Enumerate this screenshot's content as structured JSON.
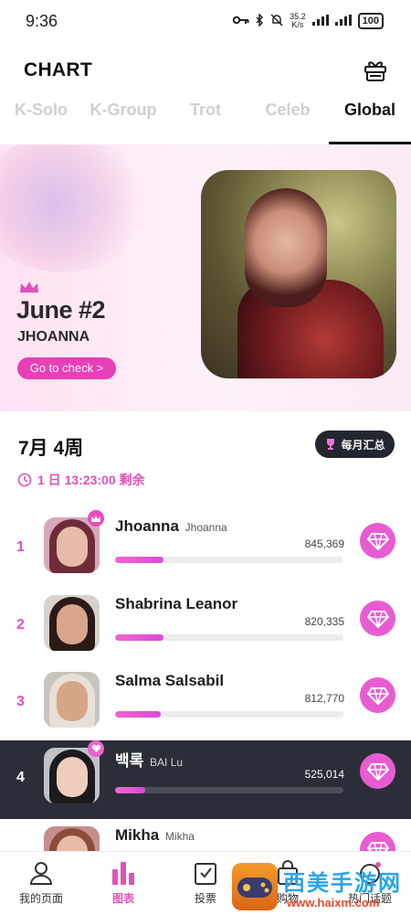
{
  "status_bar": {
    "time": "9:36",
    "speed_value": "35.2",
    "speed_unit": "K/s",
    "battery": "100"
  },
  "header": {
    "title": "CHART",
    "gift_icon": "gift-icon"
  },
  "tabs": [
    {
      "label": "K-Solo",
      "active": false
    },
    {
      "label": "K-Group",
      "active": false
    },
    {
      "label": "Trot",
      "active": false
    },
    {
      "label": "Celeb",
      "active": false
    },
    {
      "label": "Global",
      "active": true
    }
  ],
  "banner": {
    "rank_title": "June #2",
    "artist": "JHOANNA",
    "button_label": "Go to check >"
  },
  "week": {
    "title": "7月 4周",
    "monthly_button": "每月汇总",
    "countdown": "1 日 13:23:00 剩余"
  },
  "ranking": [
    {
      "rank": "1",
      "name": "Jhoanna",
      "subname": "Jhoanna",
      "votes": "845,369",
      "progress": 0.21,
      "badge": "crown",
      "highlight": false
    },
    {
      "rank": "2",
      "name": "Shabrina Leanor",
      "subname": "",
      "votes": "820,335",
      "progress": 0.21,
      "badge": "",
      "highlight": false
    },
    {
      "rank": "3",
      "name": "Salma Salsabil",
      "subname": "",
      "votes": "812,770",
      "progress": 0.2,
      "badge": "",
      "highlight": false
    },
    {
      "rank": "4",
      "name": "백록",
      "subname": "BAI Lu",
      "votes": "525,014",
      "progress": 0.13,
      "badge": "heart",
      "highlight": true
    },
    {
      "rank": "",
      "name": "Mikha",
      "subname": "Mikha",
      "votes": "",
      "progress": 0.0,
      "badge": "",
      "highlight": false
    }
  ],
  "bottom_nav": [
    {
      "label": "我的页面",
      "icon": "person-icon",
      "active": false
    },
    {
      "label": "图表",
      "icon": "bar-chart-icon",
      "active": true
    },
    {
      "label": "投票",
      "icon": "ballot-icon",
      "active": false
    },
    {
      "label": "购物",
      "icon": "shopping-bag-icon",
      "active": false
    },
    {
      "label": "热门话题",
      "icon": "topic-icon",
      "active": false
    }
  ],
  "watermark": {
    "text": "西美手游网",
    "url": "www.haixm.com"
  },
  "colors": {
    "accent": "#e052b9",
    "dark_row": "#2b2e38",
    "banner_bg": "#fde3f3"
  }
}
